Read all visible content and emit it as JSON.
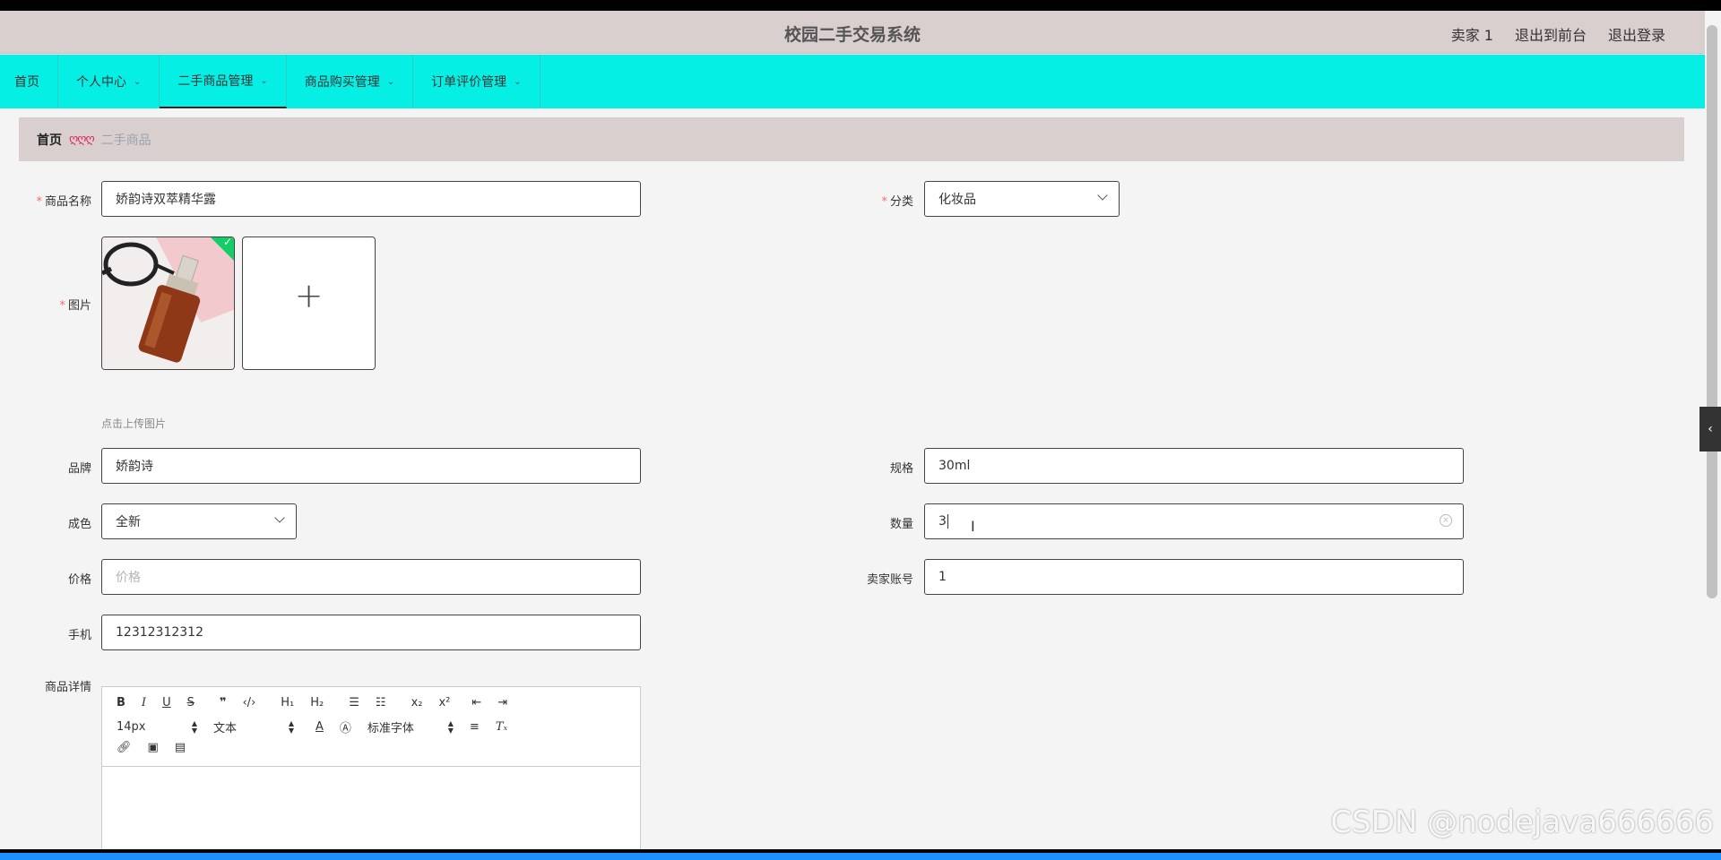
{
  "header": {
    "title": "校园二手交易系统",
    "user": "卖家 1",
    "to_front": "退出到前台",
    "logout": "退出登录"
  },
  "nav": {
    "items": [
      {
        "label": "首页"
      },
      {
        "label": "个人中心"
      },
      {
        "label": "二手商品管理"
      },
      {
        "label": "商品购买管理"
      },
      {
        "label": "订单评价管理"
      }
    ],
    "active_index": 2
  },
  "breadcrumb": {
    "home": "首页",
    "separator": "ღღღ",
    "current": "二手商品"
  },
  "form": {
    "name": {
      "label": "商品名称",
      "value": "娇韵诗双萃精华露"
    },
    "category": {
      "label": "分类",
      "value": "化妆品"
    },
    "image": {
      "label": "图片",
      "hint": "点击上传图片"
    },
    "brand": {
      "label": "品牌",
      "value": "娇韵诗"
    },
    "spec": {
      "label": "规格",
      "value": "30ml"
    },
    "condition": {
      "label": "成色",
      "value": "全新"
    },
    "quantity": {
      "label": "数量",
      "value": "3"
    },
    "price": {
      "label": "价格",
      "placeholder": "价格"
    },
    "seller_account": {
      "label": "卖家账号",
      "value": "1"
    },
    "phone": {
      "label": "手机",
      "value": "12312312312"
    },
    "details": {
      "label": "商品详情"
    }
  },
  "editor": {
    "font_size": "14px",
    "header_type": "文本",
    "font_family": "标准字体"
  },
  "watermark": "CSDN @nodejava666666",
  "colors": {
    "nav_bg": "#05efe5",
    "header_bg": "#d9cfcf",
    "required": "#f56c6c",
    "upload_success": "#13ce66"
  }
}
